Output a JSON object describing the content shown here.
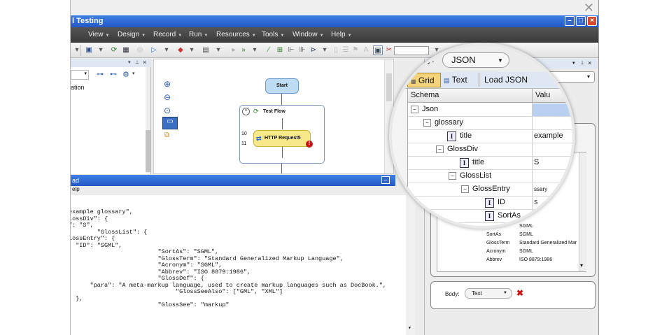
{
  "window": {
    "title": "l Testing"
  },
  "menubar": {
    "items": [
      "View",
      "Design",
      "Record",
      "Run",
      "Resources",
      "Tools",
      "Window",
      "Help"
    ]
  },
  "left_panel": {
    "text": "ation"
  },
  "flow": {
    "start": "Start",
    "test_flow": "Test Flow",
    "request": "HTTP Request5",
    "line_a": "10",
    "line_b": "11"
  },
  "editor": {
    "title": "ad",
    "menu": "elp",
    "lines": [
      "example glossary\",",
      "lossDiv\": {",
      "\": \"S\",",
      "        \"GlossList\": {",
      "lossEntry\": {",
      "  \"ID\": \"SGML\",",
      "                         \"SortAs\": \"SGML\",",
      "                         \"GlossTerm\": \"Standard Generalized Markup Language\",",
      "                         \"Acronym\": \"SGML\",",
      "                         \"Abbrev\": \"ISO 8879:1986\",",
      "                         \"GlossDef\": {",
      "      \"para\": \"A meta-markup language, used to create markup languages such as DocBook.\",",
      "                              \"GlossSeeAlso\": [\"GML\", \"XML\"]",
      "  },",
      "                         \"GlossSee\": \"markup\""
    ]
  },
  "magnifier": {
    "body_label": "ody:",
    "body_value": "JSON",
    "tabs": {
      "grid": "Grid",
      "text": "Text",
      "load": "Load JSON"
    },
    "columns": {
      "schema": "Schema",
      "value": "Valu"
    },
    "rows": [
      {
        "label": "Json",
        "value": ""
      },
      {
        "label": "glossary",
        "value": ""
      },
      {
        "label": "title",
        "value": "example"
      },
      {
        "label": "GlossDiv",
        "value": ""
      },
      {
        "label": "title",
        "value": "S"
      },
      {
        "label": "GlossList",
        "value": ""
      },
      {
        "label": "GlossEntry",
        "value": "ssary"
      },
      {
        "label": "ID",
        "value": "S"
      },
      {
        "label": "SortAs",
        "value": ""
      }
    ]
  },
  "right_panel": {
    "rows": [
      {
        "k": "ID",
        "v": "SGML"
      },
      {
        "k": "SortAs",
        "v": "SGML"
      },
      {
        "k": "GlossTerm",
        "v": "Standard Generalized Mar"
      },
      {
        "k": "Acronym",
        "v": "SGML"
      },
      {
        "k": "Abbrev",
        "v": "ISO 8879:1986"
      }
    ],
    "body2_label": "Body:",
    "body2_value": "Text"
  },
  "colors": {
    "titlebar": "#2f6ad8",
    "menubar": "#464646",
    "node_start": "#bfdcf5",
    "node_request": "#f7e98a",
    "error": "#cc1111"
  }
}
